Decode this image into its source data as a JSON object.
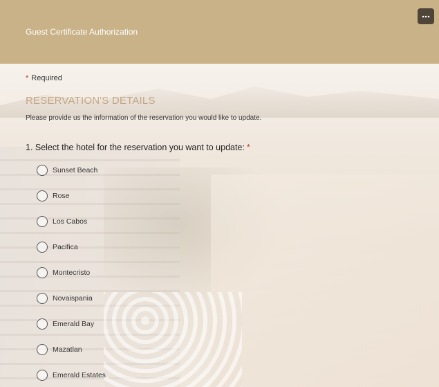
{
  "header": {
    "title": "Guest Certificate Authorization",
    "more_icon": "more-horizontal-icon"
  },
  "form": {
    "required_star": "*",
    "required_label": "Required",
    "section_title": "RESERVATION'S DETAILS",
    "section_description": "Please provide us the information of the reservation you would like to update.",
    "question": {
      "text": "1. Select the hotel for the reservation you want to update:",
      "required_star": "*",
      "options": [
        {
          "label": "Sunset Beach"
        },
        {
          "label": "Rose"
        },
        {
          "label": "Los Cabos"
        },
        {
          "label": "Pacifica"
        },
        {
          "label": "Montecristo"
        },
        {
          "label": "Novaispania"
        },
        {
          "label": "Emerald Bay"
        },
        {
          "label": "Mazatlan"
        },
        {
          "label": "Emerald Estates"
        }
      ]
    }
  },
  "colors": {
    "header_bg": "#c9b188",
    "section_title": "#c4a584",
    "required_star": "#c0392b",
    "more_button_bg": "#4e4438"
  }
}
